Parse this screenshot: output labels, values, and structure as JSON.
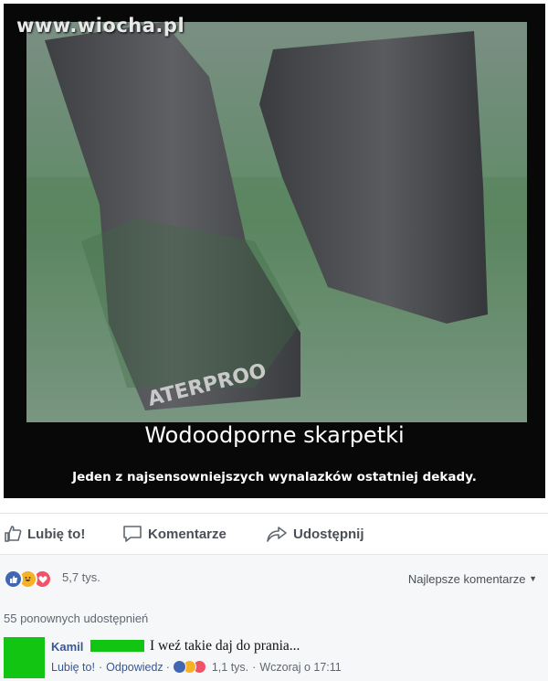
{
  "meme": {
    "watermark": "www.wiocha.pl",
    "photo_text": "ATERPROO",
    "title": "Wodoodporne skarpetki",
    "subtitle": "Jeden z najsensowniejszych wynalazków ostatniej dekady."
  },
  "actions": {
    "like_label": "Lubię to!",
    "comment_label": "Komentarze",
    "share_label": "Udostępnij"
  },
  "reactions": {
    "count": "5,7 tys.",
    "types": [
      "like-icon",
      "haha-icon",
      "love-icon"
    ],
    "colors": {
      "like": "#4267b2",
      "haha": "#f7b125",
      "love": "#f25268"
    }
  },
  "sort": {
    "label": "Najlepsze komentarze",
    "icon": "caret-down-icon"
  },
  "shares": {
    "text": "55 ponownych udostępnień"
  },
  "comment": {
    "author": "Kamil",
    "text": "I weź takie daj do prania...",
    "like_link": "Lubię to!",
    "reply_link": "Odpowiedz",
    "separator": "·",
    "reaction_count": "1,1 tys.",
    "time": "Wczoraj o 17:11"
  }
}
